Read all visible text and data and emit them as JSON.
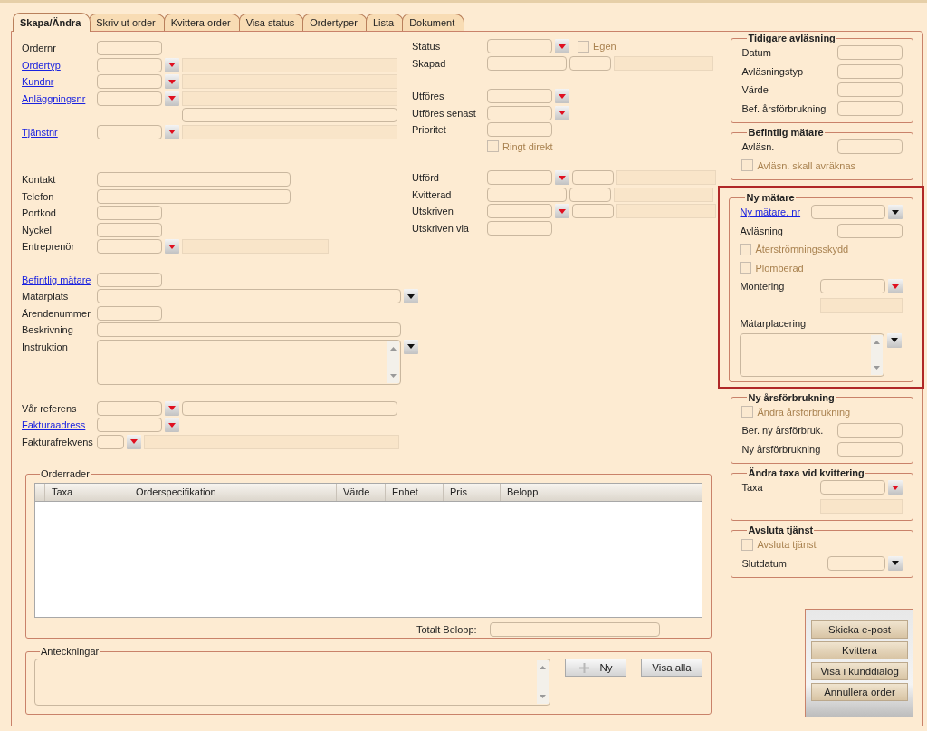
{
  "tabs": [
    {
      "label": "Skapa/Ändra",
      "selected": true
    },
    {
      "label": "Skriv ut order",
      "selected": false
    },
    {
      "label": "Kvittera order",
      "selected": false
    },
    {
      "label": "Visa status",
      "selected": false
    },
    {
      "label": "Ordertyper",
      "selected": false
    },
    {
      "label": "Lista",
      "selected": false
    },
    {
      "label": "Dokument",
      "selected": false
    }
  ],
  "left_groups": [
    [
      {
        "label": "Ordernr",
        "link": false,
        "controls": [
          {
            "kind": "field-s"
          }
        ]
      },
      {
        "label": "Ordertyp",
        "link": true,
        "controls": [
          {
            "kind": "field-s"
          },
          {
            "kind": "dropdown"
          },
          {
            "kind": "info-w"
          }
        ]
      },
      {
        "label": "Kundnr",
        "link": true,
        "controls": [
          {
            "kind": "field-s"
          },
          {
            "kind": "dropdown"
          },
          {
            "kind": "info-w"
          }
        ]
      },
      {
        "label": "Anläggningsnr",
        "link": true,
        "controls": [
          {
            "kind": "field-s"
          },
          {
            "kind": "dropdown"
          },
          {
            "kind": "info-w"
          }
        ]
      },
      {
        "controls": [
          {
            "kind": "indent"
          },
          {
            "kind": "field-w"
          }
        ]
      },
      {
        "label": "Tjänstnr",
        "link": true,
        "controls": [
          {
            "kind": "field-s"
          },
          {
            "kind": "dropdown"
          },
          {
            "kind": "info-w"
          }
        ]
      }
    ],
    [
      {
        "label": "Kontakt",
        "link": false,
        "controls": [
          {
            "kind": "field-l"
          }
        ]
      },
      {
        "label": "Telefon",
        "link": false,
        "controls": [
          {
            "kind": "field-l"
          }
        ]
      },
      {
        "label": "Portkod",
        "link": false,
        "controls": [
          {
            "kind": "field-s"
          }
        ]
      },
      {
        "label": "Nyckel",
        "link": false,
        "controls": [
          {
            "kind": "field-s"
          }
        ]
      },
      {
        "label": "Entreprenör",
        "link": false,
        "controls": [
          {
            "kind": "field-s"
          },
          {
            "kind": "dropdown"
          },
          {
            "kind": "info-m"
          }
        ]
      }
    ],
    [
      {
        "label": "Befintlig mätare",
        "link": true,
        "controls": [
          {
            "kind": "field-s"
          }
        ]
      },
      {
        "label": "Mätarplats",
        "link": false,
        "controls": [
          {
            "kind": "field-xl"
          },
          {
            "kind": "dropdown-dark"
          }
        ]
      },
      {
        "label": "Ärendenummer",
        "link": false,
        "controls": [
          {
            "kind": "field-s"
          }
        ]
      },
      {
        "label": "Beskrivning",
        "link": false,
        "controls": [
          {
            "kind": "field-xl"
          }
        ]
      },
      {
        "label": "Instruktion",
        "link": false,
        "controls": [
          {
            "kind": "textarea-l"
          },
          {
            "kind": "dropdown-dark"
          }
        ]
      }
    ],
    [
      {
        "label": "Vår referens",
        "link": false,
        "controls": [
          {
            "kind": "field-s"
          },
          {
            "kind": "dropdown"
          },
          {
            "kind": "field-w"
          }
        ]
      },
      {
        "label": "Fakturaadress",
        "link": true,
        "controls": [
          {
            "kind": "field-s"
          },
          {
            "kind": "dropdown"
          }
        ]
      },
      {
        "label": "Fakturafrekvens",
        "link": false,
        "controls": [
          {
            "kind": "field-xs"
          },
          {
            "kind": "dropdown"
          },
          {
            "kind": "info-x"
          }
        ]
      }
    ]
  ],
  "middle_groups": [
    [
      {
        "label": "Status",
        "link": false,
        "controls": [
          {
            "kind": "field-s"
          },
          {
            "kind": "dropdown"
          },
          {
            "kind": "checkbox",
            "label": "Egen",
            "checked": false
          }
        ]
      },
      {
        "label": "Skapad",
        "link": false,
        "controls": [
          {
            "kind": "field-m"
          },
          {
            "kind": "field-t"
          },
          {
            "kind": "info-s"
          }
        ]
      }
    ],
    [
      {
        "label": "Utföres",
        "link": false,
        "controls": [
          {
            "kind": "field-s"
          },
          {
            "kind": "dropdown"
          }
        ]
      },
      {
        "label": "Utföres senast",
        "link": false,
        "controls": [
          {
            "kind": "field-s"
          },
          {
            "kind": "dropdown"
          }
        ]
      },
      {
        "label": "Prioritet",
        "link": false,
        "controls": [
          {
            "kind": "field-s"
          }
        ]
      },
      {
        "controls": [
          {
            "kind": "checkbox",
            "label": "Ringt direkt",
            "checked": false
          }
        ]
      }
    ],
    [
      {
        "label": "Utförd",
        "link": false,
        "controls": [
          {
            "kind": "field-s"
          },
          {
            "kind": "dropdown"
          },
          {
            "kind": "field-t"
          },
          {
            "kind": "info-s"
          }
        ]
      },
      {
        "label": "Kvitterad",
        "link": false,
        "controls": [
          {
            "kind": "field-m"
          },
          {
            "kind": "field-t"
          },
          {
            "kind": "info-s"
          }
        ]
      },
      {
        "label": "Utskriven",
        "link": false,
        "controls": [
          {
            "kind": "field-s"
          },
          {
            "kind": "dropdown"
          },
          {
            "kind": "field-t"
          },
          {
            "kind": "info-s"
          }
        ]
      },
      {
        "label": "Utskriven via",
        "link": false,
        "controls": [
          {
            "kind": "field-s"
          }
        ]
      }
    ]
  ],
  "right_sections": [
    {
      "title": "Tidigare avläsning",
      "highlighted": false,
      "rows": [
        {
          "label": "Datum",
          "link": false,
          "controls": [
            {
              "kind": "field-s"
            }
          ]
        },
        {
          "label": "Avläsningstyp",
          "link": false,
          "controls": [
            {
              "kind": "field-s"
            }
          ]
        },
        {
          "label": "Värde",
          "link": false,
          "controls": [
            {
              "kind": "field-s"
            }
          ]
        },
        {
          "label": "Bef. årsförbrukning",
          "link": false,
          "controls": [
            {
              "kind": "field-s"
            }
          ]
        }
      ]
    },
    {
      "title": "Befintlig mätare",
      "highlighted": false,
      "rows": [
        {
          "label": "Avläsn.",
          "link": false,
          "controls": [
            {
              "kind": "field-s"
            }
          ]
        },
        {
          "controls": [
            {
              "kind": "checkbox",
              "label": "Avläsn. skall avräknas",
              "checked": false
            }
          ]
        }
      ]
    },
    {
      "title": "Ny mätare",
      "highlighted": true,
      "rows": [
        {
          "label": "Ny mätare, nr",
          "link": true,
          "controls": [
            {
              "kind": "field-r"
            },
            {
              "kind": "dropdown-dark"
            }
          ]
        },
        {
          "label": "Avläsning",
          "link": false,
          "controls": [
            {
              "kind": "field-s"
            }
          ]
        },
        {
          "controls": [
            {
              "kind": "checkbox",
              "label": "Återströmningsskydd",
              "checked": false
            }
          ]
        },
        {
          "controls": [
            {
              "kind": "checkbox",
              "label": "Plomberad",
              "checked": false
            }
          ]
        },
        {
          "label": "Montering",
          "link": false,
          "controls": [
            {
              "kind": "field-s"
            },
            {
              "kind": "dropdown"
            }
          ]
        },
        {
          "controls": [
            {
              "kind": "info-n"
            }
          ]
        },
        {
          "label": "Mätarplacering",
          "link": false,
          "controls": []
        },
        {
          "controls": [
            {
              "kind": "textarea-s"
            },
            {
              "kind": "dropdown-dark"
            }
          ]
        }
      ]
    },
    {
      "title": "Ny årsförbrukning",
      "highlighted": false,
      "rows": [
        {
          "controls": [
            {
              "kind": "checkbox",
              "label": "Ändra årsförbrukning",
              "checked": false
            }
          ]
        },
        {
          "label": "Ber. ny årsförbruk.",
          "link": false,
          "controls": [
            {
              "kind": "field-s"
            }
          ]
        },
        {
          "label": "Ny årsförbrukning",
          "link": false,
          "controls": [
            {
              "kind": "field-s"
            }
          ]
        }
      ]
    },
    {
      "title": "Ändra taxa vid kvittering",
      "highlighted": false,
      "rows": [
        {
          "label": "Taxa",
          "link": false,
          "controls": [
            {
              "kind": "field-s"
            },
            {
              "kind": "dropdown"
            }
          ]
        },
        {
          "controls": [
            {
              "kind": "info-n"
            }
          ]
        }
      ]
    },
    {
      "title": "Avsluta tjänst",
      "highlighted": false,
      "rows": [
        {
          "controls": [
            {
              "kind": "checkbox",
              "label": "Avsluta tjänst",
              "checked": false
            }
          ]
        },
        {
          "label": "Slutdatum",
          "link": false,
          "controls": [
            {
              "kind": "field-d"
            },
            {
              "kind": "dropdown-dark"
            }
          ]
        }
      ]
    }
  ],
  "action_buttons": [
    "Skicka e-post",
    "Kvittera",
    "Visa i kunddialog",
    "Annullera order"
  ],
  "order_rows": {
    "title": "Orderrader",
    "columns": [
      "Taxa",
      "Orderspecifikation",
      "Värde",
      "Enhet",
      "Pris",
      "Belopp"
    ],
    "total_label": "Totalt Belopp:"
  },
  "notes": {
    "title": "Anteckningar",
    "buttons": [
      {
        "label": "Ny",
        "kind": "add"
      },
      {
        "label": "Visa alla",
        "kind": "plain"
      }
    ]
  }
}
